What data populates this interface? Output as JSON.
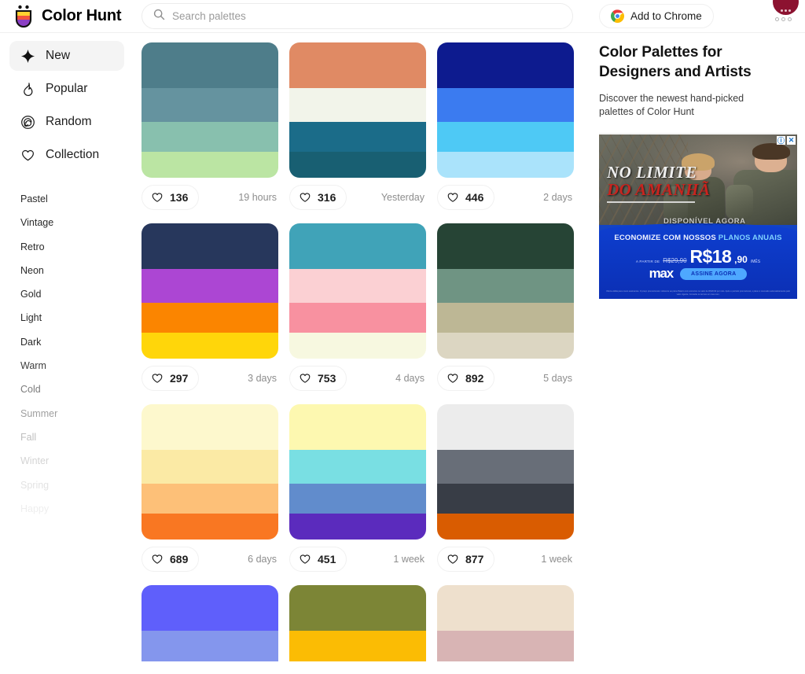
{
  "brand": {
    "name": "Color Hunt",
    "logo_icon": "colorhunt-cup-logo"
  },
  "search": {
    "placeholder": "Search palettes",
    "value": "",
    "icon": "search-icon"
  },
  "header": {
    "chrome_button": {
      "label": "Add to Chrome",
      "icon": "chrome-icon"
    },
    "menu_icon": "three-dots-icon",
    "avatar": "user-avatar"
  },
  "sidebar": {
    "nav": [
      {
        "label": "New",
        "icon": "sparkle-icon",
        "active": true
      },
      {
        "label": "Popular",
        "icon": "fire-icon",
        "active": false
      },
      {
        "label": "Random",
        "icon": "spiral-icon",
        "active": false
      },
      {
        "label": "Collection",
        "icon": "heart-icon",
        "active": false
      }
    ],
    "tags": [
      {
        "label": "Pastel",
        "opacity": 1
      },
      {
        "label": "Vintage",
        "opacity": 1
      },
      {
        "label": "Retro",
        "opacity": 1
      },
      {
        "label": "Neon",
        "opacity": 1
      },
      {
        "label": "Gold",
        "opacity": 1
      },
      {
        "label": "Light",
        "opacity": 1
      },
      {
        "label": "Dark",
        "opacity": 1
      },
      {
        "label": "Warm",
        "opacity": 0.9
      },
      {
        "label": "Cold",
        "opacity": 0.62
      },
      {
        "label": "Summer",
        "opacity": 0.45
      },
      {
        "label": "Fall",
        "opacity": 0.3
      },
      {
        "label": "Winter",
        "opacity": 0.2
      },
      {
        "label": "Spring",
        "opacity": 0.13
      },
      {
        "label": "Happy",
        "opacity": 0.08
      }
    ]
  },
  "palettes": [
    {
      "colors": [
        "#4e7d8a",
        "#65939f",
        "#88c0ae",
        "#bbe5a3"
      ],
      "likes": "136",
      "age": "19 hours"
    },
    {
      "colors": [
        "#e08a64",
        "#f2f4ea",
        "#1b6c89",
        "#185f72"
      ],
      "likes": "316",
      "age": "Yesterday"
    },
    {
      "colors": [
        "#0d1b8f",
        "#3b7bf0",
        "#4ec9f5",
        "#aae3fb"
      ],
      "likes": "446",
      "age": "2 days"
    },
    {
      "colors": [
        "#27375c",
        "#ac46d3",
        "#fb8500",
        "#ffd60a"
      ],
      "likes": "297",
      "age": "3 days"
    },
    {
      "colors": [
        "#40a3b8",
        "#fbd0d3",
        "#f891a0",
        "#f7f8e0"
      ],
      "likes": "753",
      "age": "4 days"
    },
    {
      "colors": [
        "#264435",
        "#6f9483",
        "#bdb795",
        "#dcd6c2"
      ],
      "likes": "892",
      "age": "5 days"
    },
    {
      "colors": [
        "#fdf8cd",
        "#fbeaa5",
        "#fdc078",
        "#f97722"
      ],
      "likes": "689",
      "age": "6 days"
    },
    {
      "colors": [
        "#fdf8b0",
        "#79dfe3",
        "#618ccc",
        "#5b2bbd"
      ],
      "likes": "451",
      "age": "1 week"
    },
    {
      "colors": [
        "#ececec",
        "#686e78",
        "#383d46",
        "#d95c01"
      ],
      "likes": "877",
      "age": "1 week"
    }
  ],
  "palettes_partial": [
    {
      "colors": [
        "#5f5ffb",
        "#8496ed"
      ]
    },
    {
      "colors": [
        "#7c8536",
        "#fbbc04"
      ]
    },
    {
      "colors": [
        "#eee0cd",
        "#d8b4b4"
      ]
    }
  ],
  "right_panel": {
    "title": "Color Palettes for Designers and Artists",
    "description": "Discover the newest hand-picked palettes of Color Hunt"
  },
  "ad": {
    "title_line1": "NO LIMITE",
    "title_line2": "DO AMANHÃ",
    "availability": "DISPONÍVEL AGORA",
    "promo_prefix": "ECONOMIZE COM NOSSOS ",
    "promo_highlight": "PLANOS ANUAIS",
    "from_label": "A PARTIR DE",
    "old_price": "R$29,90",
    "new_price": "R$18",
    "cents": ",90",
    "period": "/MÊS",
    "brand": "max",
    "cta": "ASSINE AGORA",
    "legal": "Oferta válida para novos assinantes. O preço promocional é referente ao plano Básico com anúncios no valor de R$18,90 por mês. Após o período promocional, o plano é renovado automaticamente pelo valor vigente. Consulte os termos em max.com.",
    "badge_info": "ⓘ",
    "badge_close": "✕"
  },
  "icons": {
    "heart": "heart-icon",
    "search": "search-icon"
  }
}
